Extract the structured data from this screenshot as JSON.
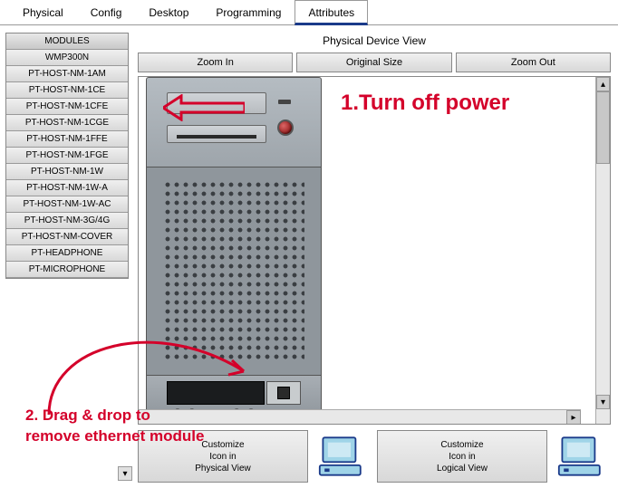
{
  "tabs": {
    "physical": "Physical",
    "config": "Config",
    "desktop": "Desktop",
    "programming": "Programming",
    "attributes": "Attributes",
    "active": "Attributes"
  },
  "sidebar": {
    "header": "MODULES",
    "items": [
      "WMP300N",
      "PT-HOST-NM-1AM",
      "PT-HOST-NM-1CE",
      "PT-HOST-NM-1CFE",
      "PT-HOST-NM-1CGE",
      "PT-HOST-NM-1FFE",
      "PT-HOST-NM-1FGE",
      "PT-HOST-NM-1W",
      "PT-HOST-NM-1W-A",
      "PT-HOST-NM-1W-AC",
      "PT-HOST-NM-3G/4G",
      "PT-HOST-NM-COVER",
      "PT-HEADPHONE",
      "PT-MICROPHONE"
    ]
  },
  "main": {
    "title": "Physical Device View",
    "zoom_in": "Zoom In",
    "original": "Original Size",
    "zoom_out": "Zoom Out",
    "customize_physical": "Customize\nIcon in\nPhysical View",
    "customize_logical": "Customize\nIcon in\nLogical View"
  },
  "annotations": {
    "step1_num": "1.",
    "step1_text": "Turn off power",
    "step2_text": "2. Drag & drop to remove ethernet module"
  },
  "colors": {
    "accent": "#d4002a",
    "tab_underline": "#1a3a8a"
  }
}
